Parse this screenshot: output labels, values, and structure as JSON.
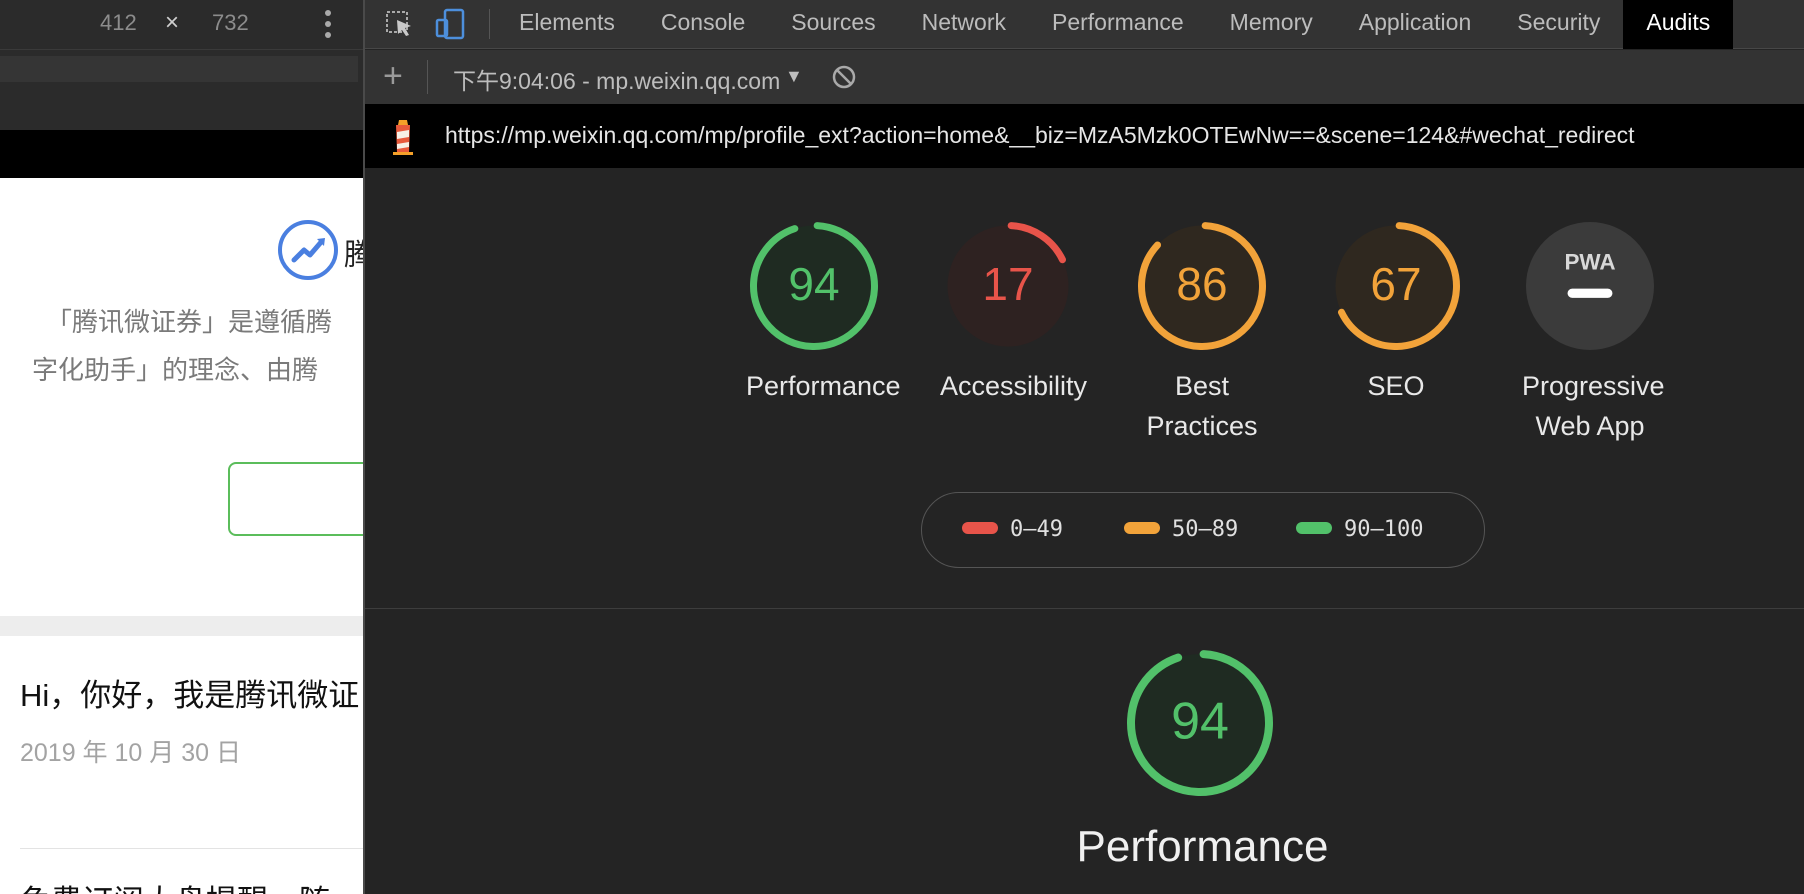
{
  "device": {
    "width": "412",
    "times": "×",
    "height": "732"
  },
  "page": {
    "account_name": "腾",
    "intro_line1": "「腾讯微证券」是遵循腾",
    "intro_line2": "字化助手」的理念、由腾",
    "article_title": "Hi，你好，我是腾讯微证",
    "article_date": "2019 年 10 月 30 日",
    "article2_title": "免费订阅大盘提醒，随"
  },
  "devtools": {
    "tabs": [
      "Elements",
      "Console",
      "Sources",
      "Network",
      "Performance",
      "Memory",
      "Application",
      "Security",
      "Audits"
    ],
    "active_tab": "Audits"
  },
  "audits": {
    "add": "+",
    "report_select": "下午9:04:06 - mp.weixin.qq.com",
    "url": "https://mp.weixin.qq.com/mp/profile_ext?action=home&__biz=MzA5Mzk0OTEwNw==&scene=124&#wechat_redirect",
    "categories": [
      {
        "score": 94,
        "label": "Performance",
        "rating": "pass"
      },
      {
        "score": 17,
        "label": "Accessibility",
        "rating": "fail"
      },
      {
        "score": 86,
        "label": "Best Practices",
        "rating": "average"
      },
      {
        "score": 67,
        "label": "SEO",
        "rating": "average"
      },
      {
        "score": null,
        "label": "Progressive Web App",
        "rating": "pwa",
        "badge": "PWA"
      }
    ],
    "legend": [
      {
        "range": "0–49",
        "color": "#e8544a"
      },
      {
        "range": "50–89",
        "color": "#f2a33a"
      },
      {
        "range": "90–100",
        "color": "#52c16a"
      }
    ],
    "section": {
      "score": 94,
      "title": "Performance"
    }
  },
  "colors": {
    "pass": "#52c16a",
    "average": "#f2a33a",
    "fail": "#e8544a",
    "pass_bg": "#1f2b22",
    "average_bg": "#2f281f",
    "fail_bg": "#2e2221",
    "pwa_bg": "#3b3b3b"
  }
}
